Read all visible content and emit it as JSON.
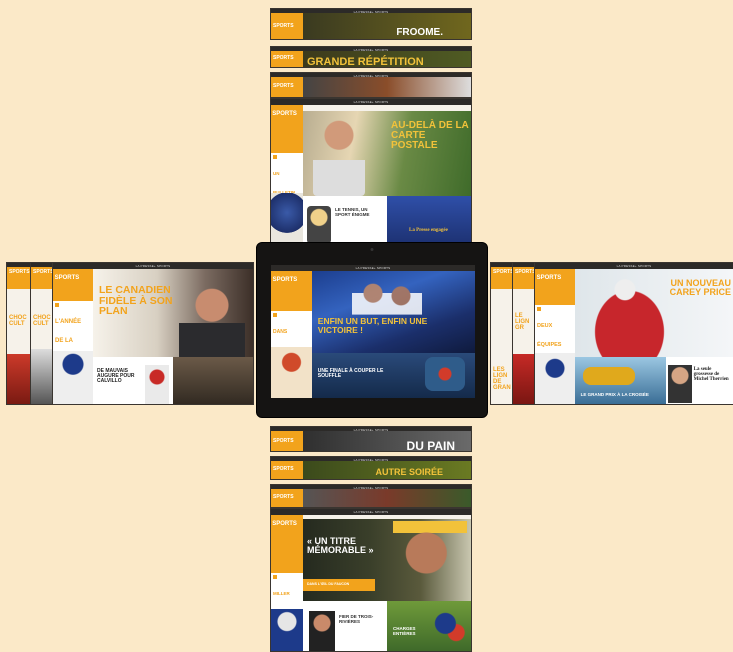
{
  "brand": "LA PRESSE+ SPORTS",
  "section_label": "SPORTS",
  "top_stack": [
    {
      "headline": "FROOME."
    },
    {
      "headline": "GRANDE RÉPÉTITION"
    },
    {
      "headline": ""
    }
  ],
  "top_main": {
    "headline": "AU-DELÀ DE LA CARTE POSTALE",
    "sidebar_teaser": "UN BULLETIN AVANT LA SEMAINE DE RELÂCHE",
    "sub1": "LE TENNIS, UN SPORT ÉNIGME",
    "sub2": "La Presse engagée"
  },
  "left_main": {
    "headline": "LE CANADIEN FIDÈLE À SON PLAN",
    "sidebar_teaser": "L'ANNÉE DE LA MATURITÉ",
    "sub1": "DE MAUVAIS AUGURE POUR CALVILLO",
    "slivers": [
      "CHOC CULT",
      "CHOC CULT"
    ]
  },
  "center": {
    "headline": "ENFIN UN BUT, ENFIN UNE VICTOIRE !",
    "sidebar_teaser": "DANS L'ANTRE DE LA BÊTE",
    "sub1": "UNE FINALE À COUPER LE SOUFFLE"
  },
  "right_main": {
    "headline": "UN NOUVEAU CAREY PRICE",
    "sidebar_teaser": "DEUX ÉQUIPES SUR LEUR DÉCLIN",
    "sub1": "LE GRAND PRIX À LA CROISÉE",
    "sub2": "La seule grossesse de Michel Therrien",
    "slivers": [
      "LES LIGN DE GRAN",
      "LE LIGN GR"
    ]
  },
  "bottom_stack": [
    {
      "headline": "DU PAIN"
    },
    {
      "headline": "AUTRE SOIRÉE"
    },
    {
      "headline": ""
    }
  ],
  "bottom_main": {
    "headline": "« UN TITRE MÉMORABLE »",
    "sidebar_teaser": "MILLER ACCEPTE DE RESTER",
    "tag": "DANS L'ŒIL DU FAUCON",
    "sub1": "FIER DE TROIS-RIVIÈRES",
    "sub2": "CHARGES ENTIÈRES"
  }
}
